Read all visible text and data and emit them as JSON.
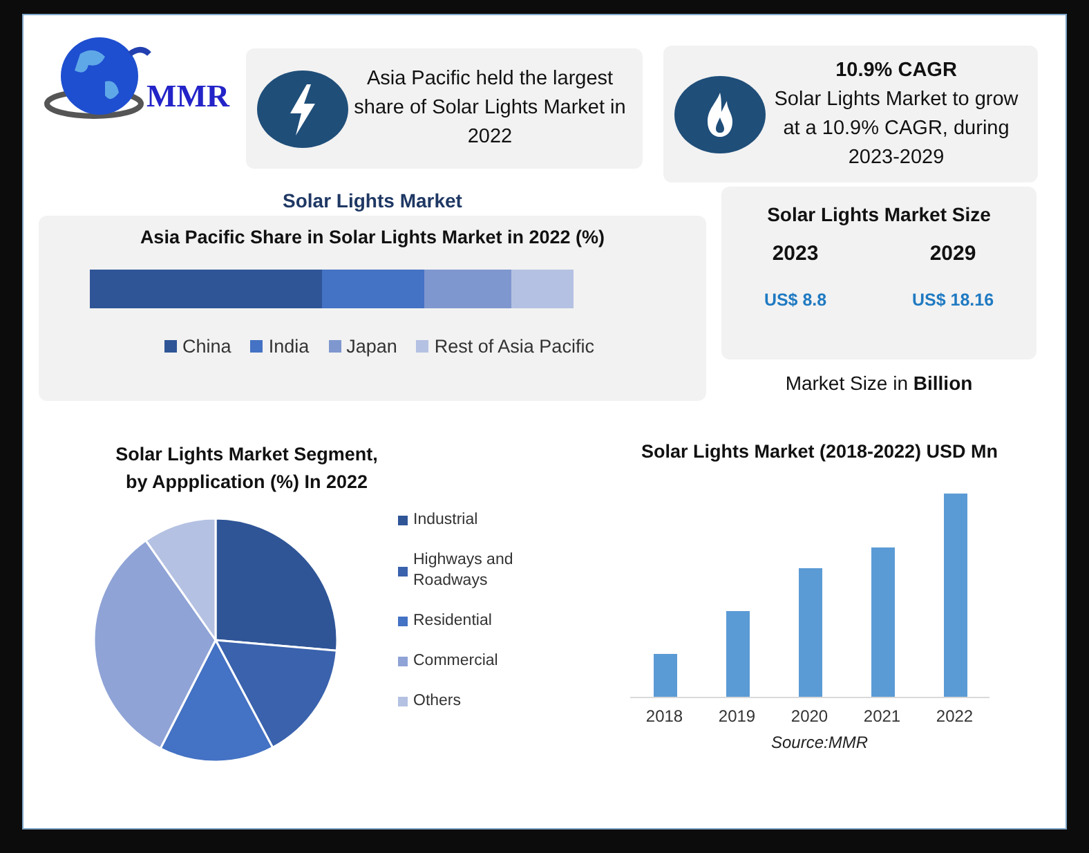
{
  "logo": {
    "text": "MMR"
  },
  "highlights": [
    {
      "kind": "bolt",
      "text": "Asia Pacific held the largest share of Solar Lights Market in 2022"
    },
    {
      "kind": "flame",
      "title": "10.9% CAGR",
      "text": "Solar Lights Market to grow at a 10.9% CAGR, during 2023-2029"
    }
  ],
  "share_section": {
    "heading": "Solar Lights Market",
    "title": "Asia Pacific Share in Solar Lights Market in 2022 (%)",
    "legend": [
      {
        "label": "China",
        "color": "#2f5597"
      },
      {
        "label": "India",
        "color": "#4472c4"
      },
      {
        "label": "Japan",
        "color": "#7f97cf"
      },
      {
        "label": "Rest of Asia Pacific",
        "color": "#b4c1e2"
      }
    ]
  },
  "market_size": {
    "title": "Solar Lights Market Size",
    "columns": [
      {
        "year": "2023",
        "value": "US$ 8.8"
      },
      {
        "year": "2029",
        "value": "US$ 18.16"
      }
    ],
    "note": "Market Size in **Billion**"
  },
  "segment_chart": {
    "title": "Solar Lights Market Segment, by Appplication (%) In 2022",
    "legend": [
      {
        "label": "Industrial",
        "color": "#2f5597"
      },
      {
        "label": "Highways and Roadways",
        "color": "#3a62ad"
      },
      {
        "label": "Residential",
        "color": "#4472c4"
      },
      {
        "label": "Commercial",
        "color": "#8fa3d6"
      },
      {
        "label": "Others",
        "color": "#b4c1e2"
      }
    ]
  },
  "bar_chart": {
    "title": "Solar Lights Market (2018-2022) USD Mn",
    "categories": [
      "2018",
      "2019",
      "2020",
      "2021",
      "2022"
    ],
    "source": "Source:MMR"
  }
}
